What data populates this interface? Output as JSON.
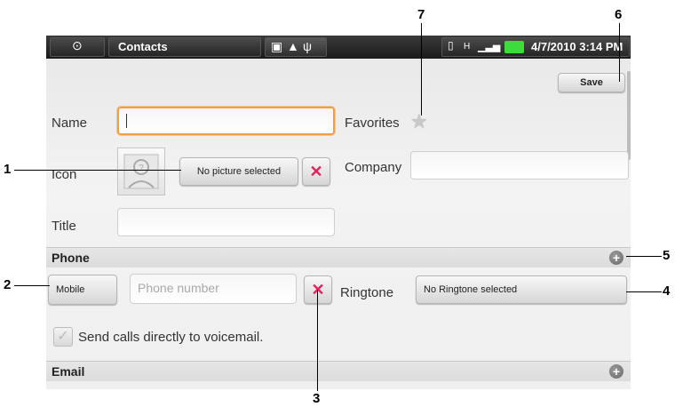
{
  "statusbar": {
    "app_title": "Contacts",
    "datetime": "4/7/2010 3:14 PM"
  },
  "form": {
    "save_label": "Save",
    "name_label": "Name",
    "name_value": "",
    "favorites_label": "Favorites",
    "icon_label": "Icon",
    "picture_button": "No picture selected",
    "company_label": "Company",
    "company_value": "",
    "title_label": "Title",
    "title_value": ""
  },
  "phone": {
    "section_title": "Phone",
    "type_button": "Mobile",
    "number_placeholder": "Phone number",
    "ringtone_label": "Ringtone",
    "ringtone_button": "No Ringtone selected",
    "voicemail_label": "Send calls directly to voicemail.",
    "voicemail_checked": false
  },
  "email": {
    "section_title": "Email"
  },
  "callouts": [
    "1",
    "2",
    "3",
    "4",
    "5",
    "6",
    "7"
  ],
  "colors": {
    "focus": "#f0a040",
    "delete": "#e0245e",
    "battery": "#3ddc3d"
  }
}
